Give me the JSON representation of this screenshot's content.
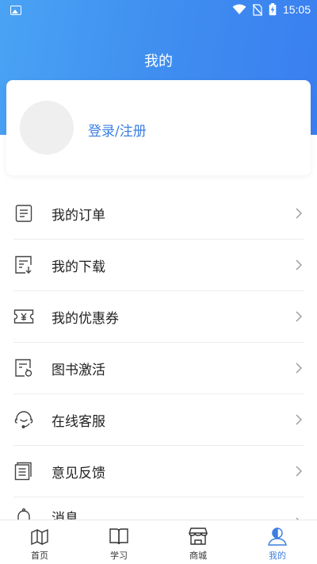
{
  "statusbar": {
    "time": "15:05"
  },
  "header": {
    "title": "我的"
  },
  "profile": {
    "login_text": "登录/注册"
  },
  "menu": {
    "items": [
      {
        "label": "我的订单",
        "icon": "order-list-icon"
      },
      {
        "label": "我的下载",
        "icon": "download-icon"
      },
      {
        "label": "我的优惠券",
        "icon": "coupon-icon"
      },
      {
        "label": "图书激活",
        "icon": "book-activate-icon"
      },
      {
        "label": "在线客服",
        "icon": "headset-icon"
      },
      {
        "label": "意见反馈",
        "icon": "feedback-icon"
      },
      {
        "label": "消息",
        "icon": "bell-icon"
      }
    ]
  },
  "tabbar": {
    "tabs": [
      {
        "label": "首页",
        "icon": "home-book-icon"
      },
      {
        "label": "学习",
        "icon": "open-book-icon"
      },
      {
        "label": "商城",
        "icon": "store-icon"
      },
      {
        "label": "我的",
        "icon": "user-icon",
        "active": true
      }
    ]
  },
  "colors": {
    "accent": "#3b7fe0",
    "header_start": "#4aa3f4",
    "header_end": "#3a7ff0"
  }
}
